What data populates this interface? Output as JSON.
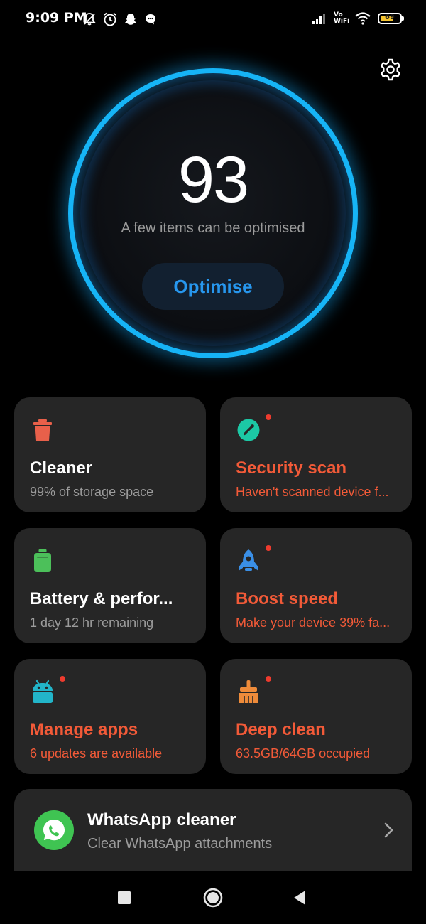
{
  "status_bar": {
    "time": "9:09 PM",
    "left_icons": [
      "bell-muted-icon",
      "alarm-icon",
      "snapchat-icon",
      "chat-bubble-icon"
    ],
    "right_icons": [
      "signal-icon",
      "vowifi-icon",
      "wifi-icon",
      "battery-icon"
    ],
    "vowifi_label_top": "Vo",
    "vowifi_label_bottom": "WiFi",
    "battery_level": "69"
  },
  "header": {
    "settings_icon": "gear-icon"
  },
  "score": {
    "value": "93",
    "caption": "A few items can be optimised",
    "action_label": "Optimise",
    "accent_color": "#16b4f6"
  },
  "tiles": [
    {
      "icon": "trash-icon",
      "icon_color": "#e8604a",
      "title": "Cleaner",
      "subtitle": "99% of storage space",
      "style": "normal",
      "has_dot": false
    },
    {
      "icon": "security-scan-icon",
      "icon_color": "#1cc8a5",
      "title": "Security scan",
      "subtitle": "Haven't scanned device f...",
      "style": "alert",
      "has_dot": true
    },
    {
      "icon": "battery-tile-icon",
      "icon_color": "#4cc05a",
      "title": "Battery & perfor...",
      "subtitle": "1 day 12 hr  remaining",
      "style": "normal",
      "has_dot": false
    },
    {
      "icon": "rocket-icon",
      "icon_color": "#3a8fe6",
      "title": "Boost speed",
      "subtitle": "Make your device 39% fa...",
      "style": "alert",
      "has_dot": true
    },
    {
      "icon": "android-icon",
      "icon_color": "#22b5c9",
      "title": "Manage apps",
      "subtitle": "6 updates are available",
      "style": "alert",
      "has_dot": true
    },
    {
      "icon": "broom-icon",
      "icon_color": "#ee8b3a",
      "title": "Deep clean",
      "subtitle": "63.5GB/64GB occupied",
      "style": "alert",
      "has_dot": true
    }
  ],
  "whatsapp_cleaner": {
    "icon": "whatsapp-icon",
    "icon_color": "#3fc452",
    "title": "WhatsApp cleaner",
    "subtitle": "Clear WhatsApp attachments",
    "chevron_icon": "chevron-right-icon"
  },
  "navigation": {
    "buttons": [
      "recents-square-icon",
      "home-circle-icon",
      "back-triangle-icon"
    ]
  },
  "colors": {
    "alert_text": "#f25a38",
    "alert_dot": "#ee3b2e",
    "tile_background": "#262626",
    "muted_text": "#9c9c9c"
  }
}
